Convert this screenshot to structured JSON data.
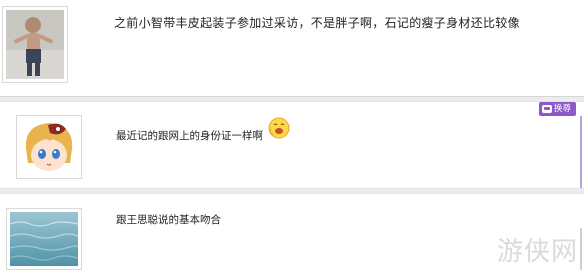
{
  "posts": [
    {
      "text": "之前小智带丰皮起装子参加过采访，不是胖子啊，石记的瘦子身材还比较像"
    },
    {
      "text": "最近记的跟网上的身份证一样啊",
      "emoji": "grinning-emoji",
      "badge": "换尊"
    },
    {
      "text": "跟王思聪说的基本吻合"
    }
  ],
  "watermark": "游侠网",
  "colors": {
    "badge": "#8e58c9",
    "divider": "#ececec",
    "text": "#222222"
  }
}
